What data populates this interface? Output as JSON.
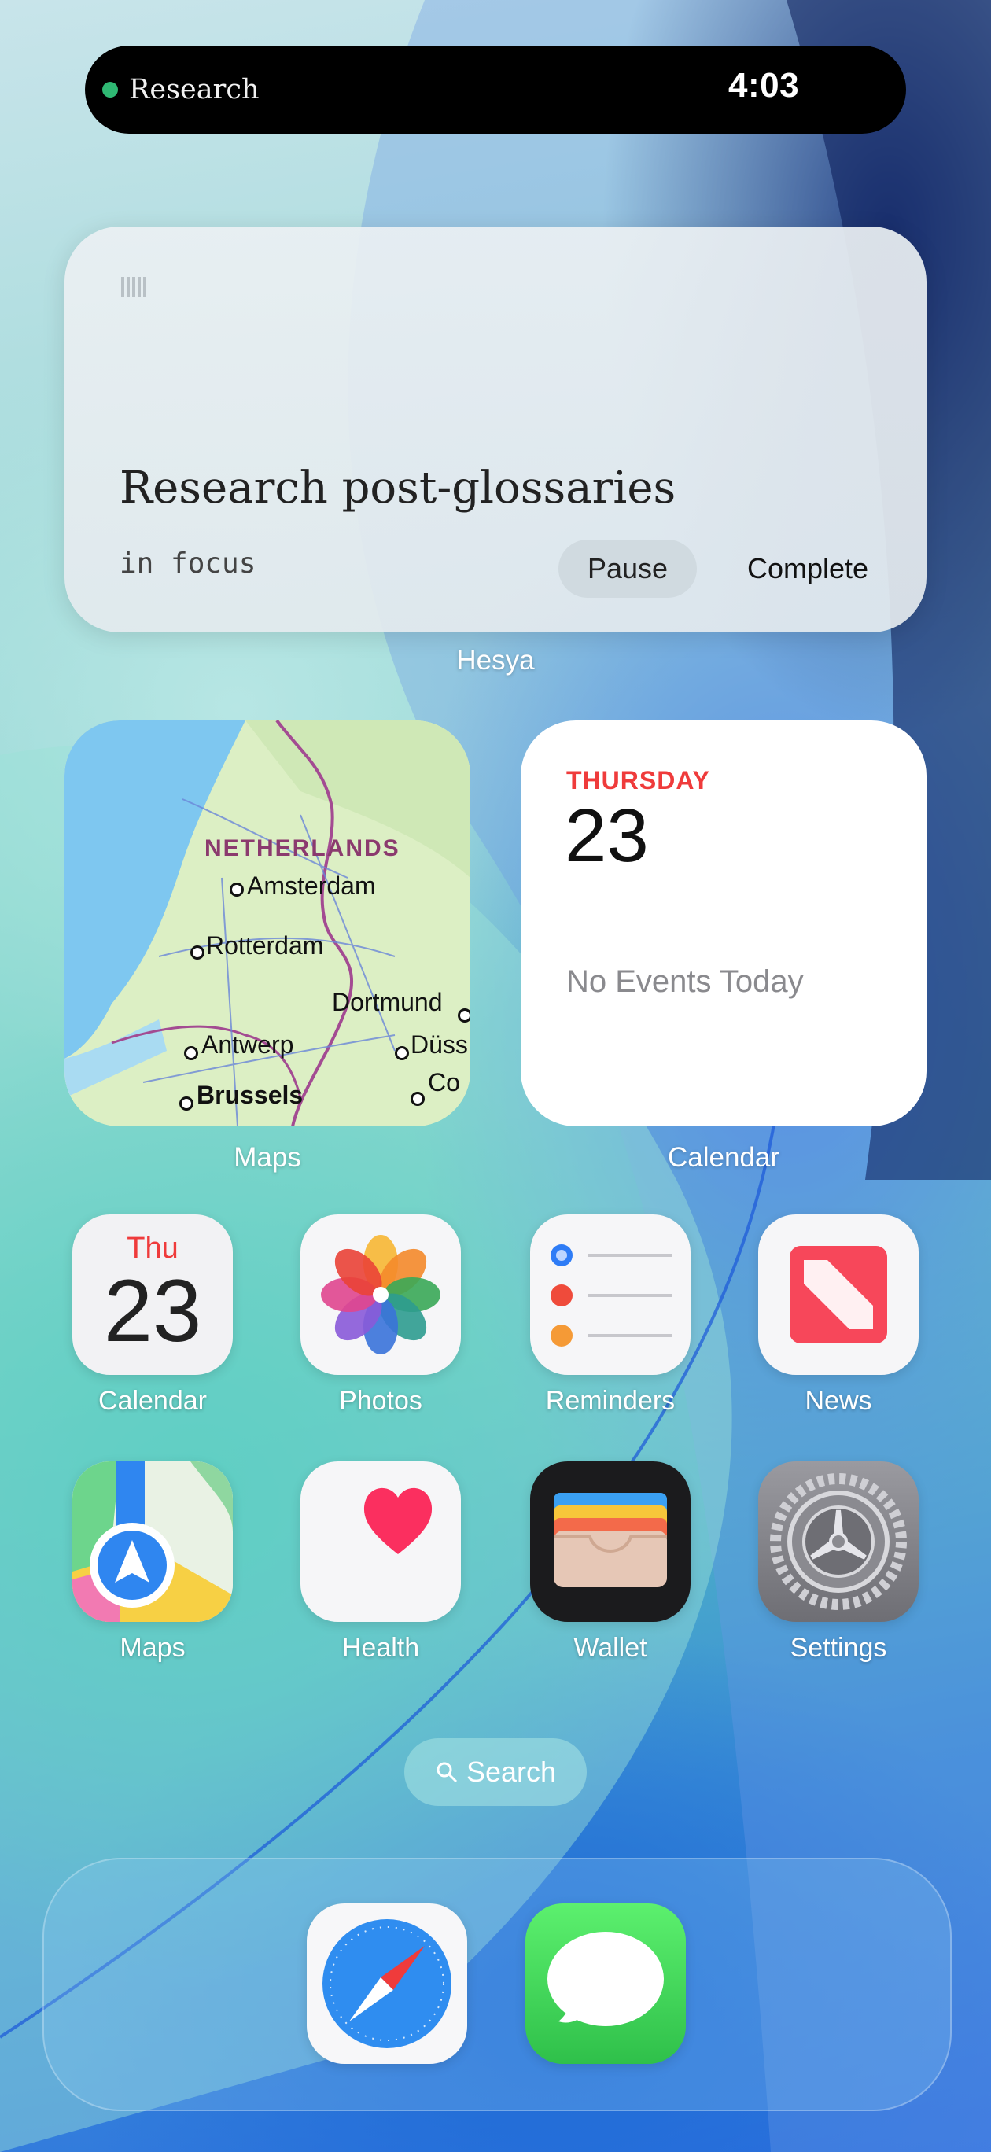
{
  "status": {
    "activity": "Research",
    "time": "4:03",
    "colors": {
      "dot": "#2fb873"
    }
  },
  "focus_widget": {
    "task": "Research post-glossaries",
    "state": "in focus",
    "pause_label": "Pause",
    "complete_label": "Complete",
    "app_name": "Hesya"
  },
  "maps_widget": {
    "label": "Maps",
    "country": "NETHERLANDS",
    "cities": [
      "Amsterdam",
      "Rotterdam",
      "Dortmund",
      "Antwerp",
      "Düss",
      "Brussels",
      "Co"
    ]
  },
  "calendar_widget": {
    "label": "Calendar",
    "weekday": "THURSDAY",
    "date": "23",
    "message": "No Events Today"
  },
  "apps": [
    {
      "name": "Calendar",
      "icon": "calendar-icon",
      "weekday": "Thu",
      "date": "23"
    },
    {
      "name": "Photos",
      "icon": "photos-icon"
    },
    {
      "name": "Reminders",
      "icon": "reminders-icon"
    },
    {
      "name": "News",
      "icon": "news-icon"
    },
    {
      "name": "Maps",
      "icon": "maps-icon"
    },
    {
      "name": "Health",
      "icon": "health-icon"
    },
    {
      "name": "Wallet",
      "icon": "wallet-icon"
    },
    {
      "name": "Settings",
      "icon": "settings-icon"
    }
  ],
  "search": {
    "label": "Search"
  },
  "dock": [
    {
      "name": "Safari",
      "icon": "safari-icon"
    },
    {
      "name": "Messages",
      "icon": "messages-icon"
    }
  ]
}
